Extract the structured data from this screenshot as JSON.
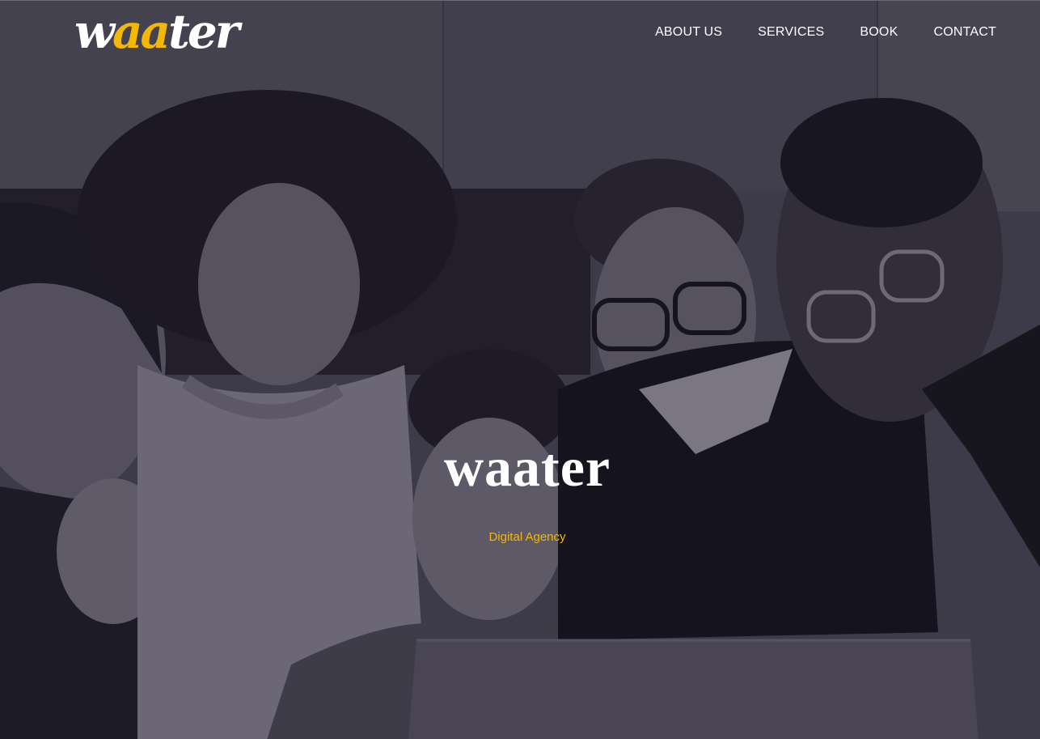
{
  "brand": {
    "logo_parts": [
      "w",
      "aa",
      "ter"
    ],
    "logo_accent_color": "#f5b800"
  },
  "nav": {
    "items": [
      {
        "label": "ABOUT US"
      },
      {
        "label": "SERVICES"
      },
      {
        "label": "BOOK"
      },
      {
        "label": "CONTACT"
      }
    ]
  },
  "hero": {
    "title": "waater",
    "subtitle": "Digital Agency",
    "photo_icon": "group-of-people-photo"
  }
}
